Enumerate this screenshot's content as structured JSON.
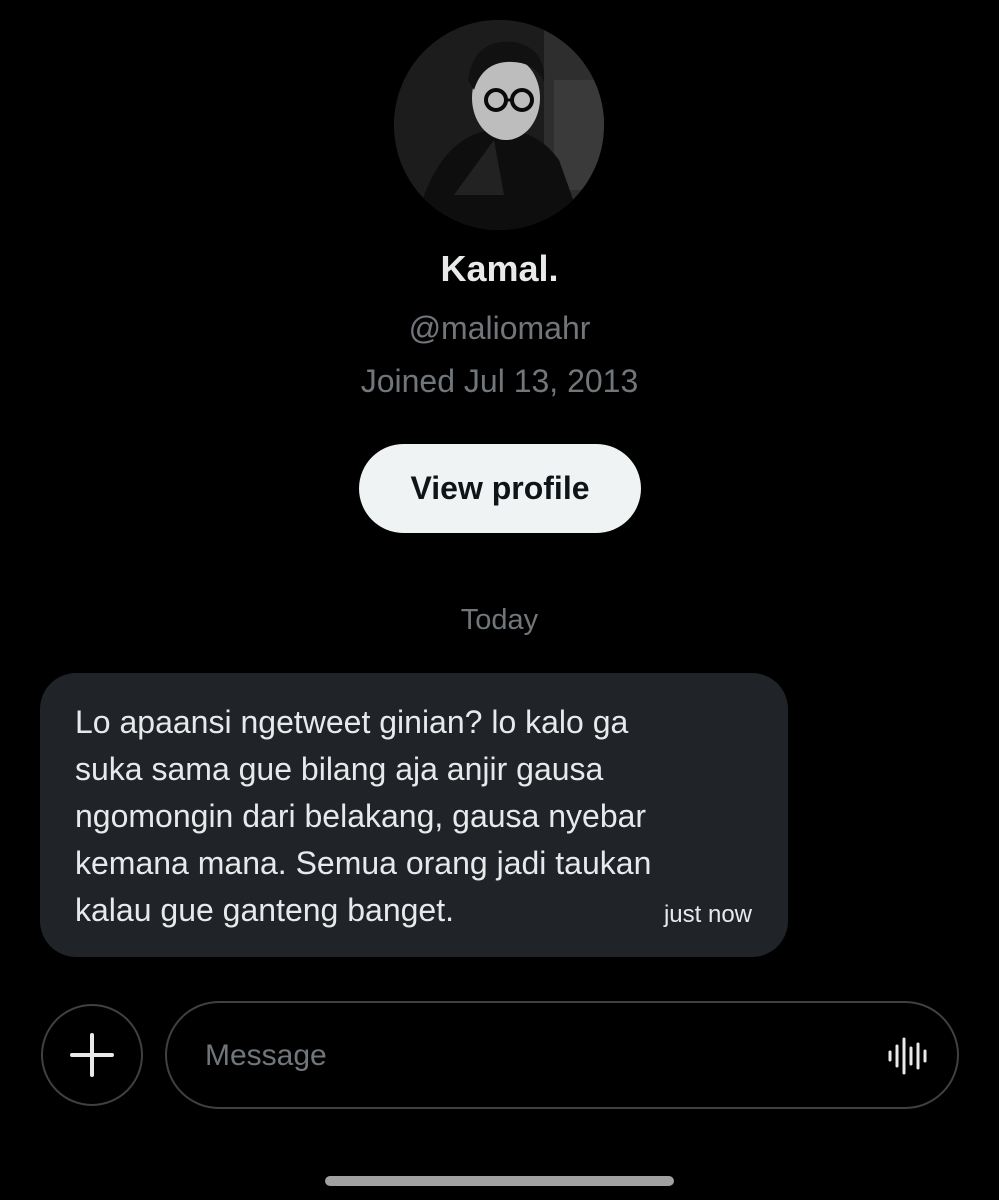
{
  "profile": {
    "name": "Kamal.",
    "handle": "@maliomahr",
    "joined": "Joined Jul 13, 2013",
    "view_profile_label": "View profile"
  },
  "conversation": {
    "day_divider": "Today",
    "messages": [
      {
        "text": "Lo apaansi ngetweet ginian? lo kalo ga\nsuka sama gue bilang aja anjir gausa\nngomongin dari belakang, gausa nyebar\nkemana mana. Semua orang jadi taukan\nkalau gue ganteng banget.",
        "time": "just now"
      }
    ]
  },
  "composer": {
    "placeholder": "Message",
    "add_icon": "plus-icon",
    "voice_icon": "voice-waveform-icon"
  },
  "colors": {
    "background": "#000000",
    "bubble": "#202327",
    "primary_text": "#e7e9ea",
    "secondary_text": "#71767b",
    "button_bg": "#eff3f4"
  }
}
